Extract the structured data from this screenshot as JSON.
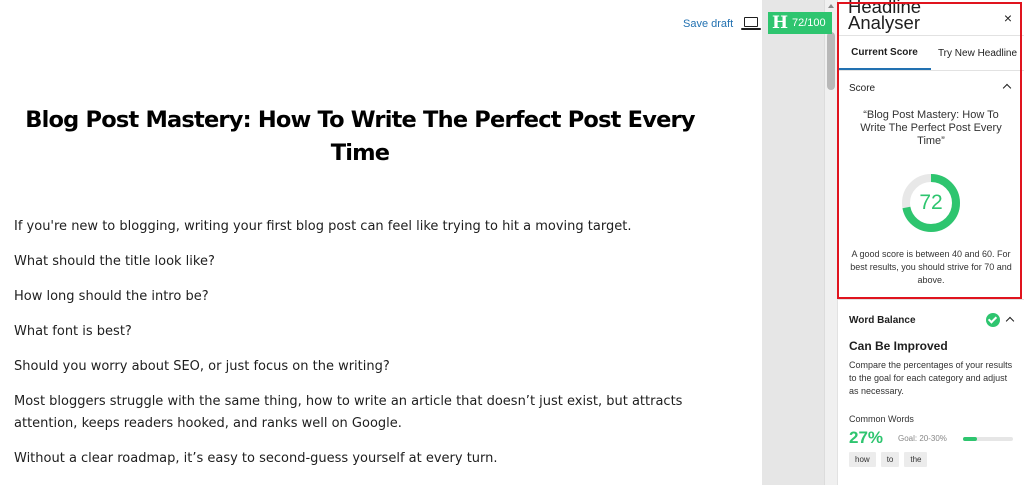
{
  "toolbar": {
    "save_draft": "Save draft",
    "badge_letter": "H",
    "badge_score": "72/100"
  },
  "post": {
    "title": "Blog Post Mastery: How To Write The Perfect Post Every Time",
    "paragraphs": [
      "If you're new to blogging, writing your first blog post can feel like trying to hit a moving target.",
      "What should the title look like?",
      "How long should the intro be?",
      "What font is best?",
      "Should you worry about SEO, or just focus on the writing?",
      "Most bloggers struggle with the same thing, how to write an article that doesn’t just exist, but attracts attention, keeps readers hooked, and ranks well on Google.",
      "Without a clear roadmap, it’s easy to second-guess yourself at every turn."
    ]
  },
  "sidebar": {
    "title_line1": "Headline",
    "title_line2": "Analyser",
    "close": "×",
    "tabs": [
      "Current Score",
      "Try New Headline"
    ],
    "score_section": {
      "label": "Score",
      "headline_quote": "“Blog Post Mastery: How To Write The Perfect Post Every Time”",
      "score": 72,
      "score_text": "72",
      "hint": "A good score is between 40 and 60. For best results, you should strive for 70 and above."
    },
    "word_balance": {
      "label": "Word Balance",
      "status": "Can Be Improved",
      "description": "Compare the percentages of your results to the goal for each category and adjust as necessary.",
      "common_words_label": "Common Words",
      "common_words_pct": "27%",
      "common_words_goal": "Goal: 20-30%",
      "common_words_fraction": 0.27,
      "chips": [
        "how",
        "to",
        "the"
      ]
    }
  },
  "colors": {
    "accent_green": "#2ec56f",
    "highlight_red": "#e0141e",
    "link_blue": "#2271b1"
  }
}
